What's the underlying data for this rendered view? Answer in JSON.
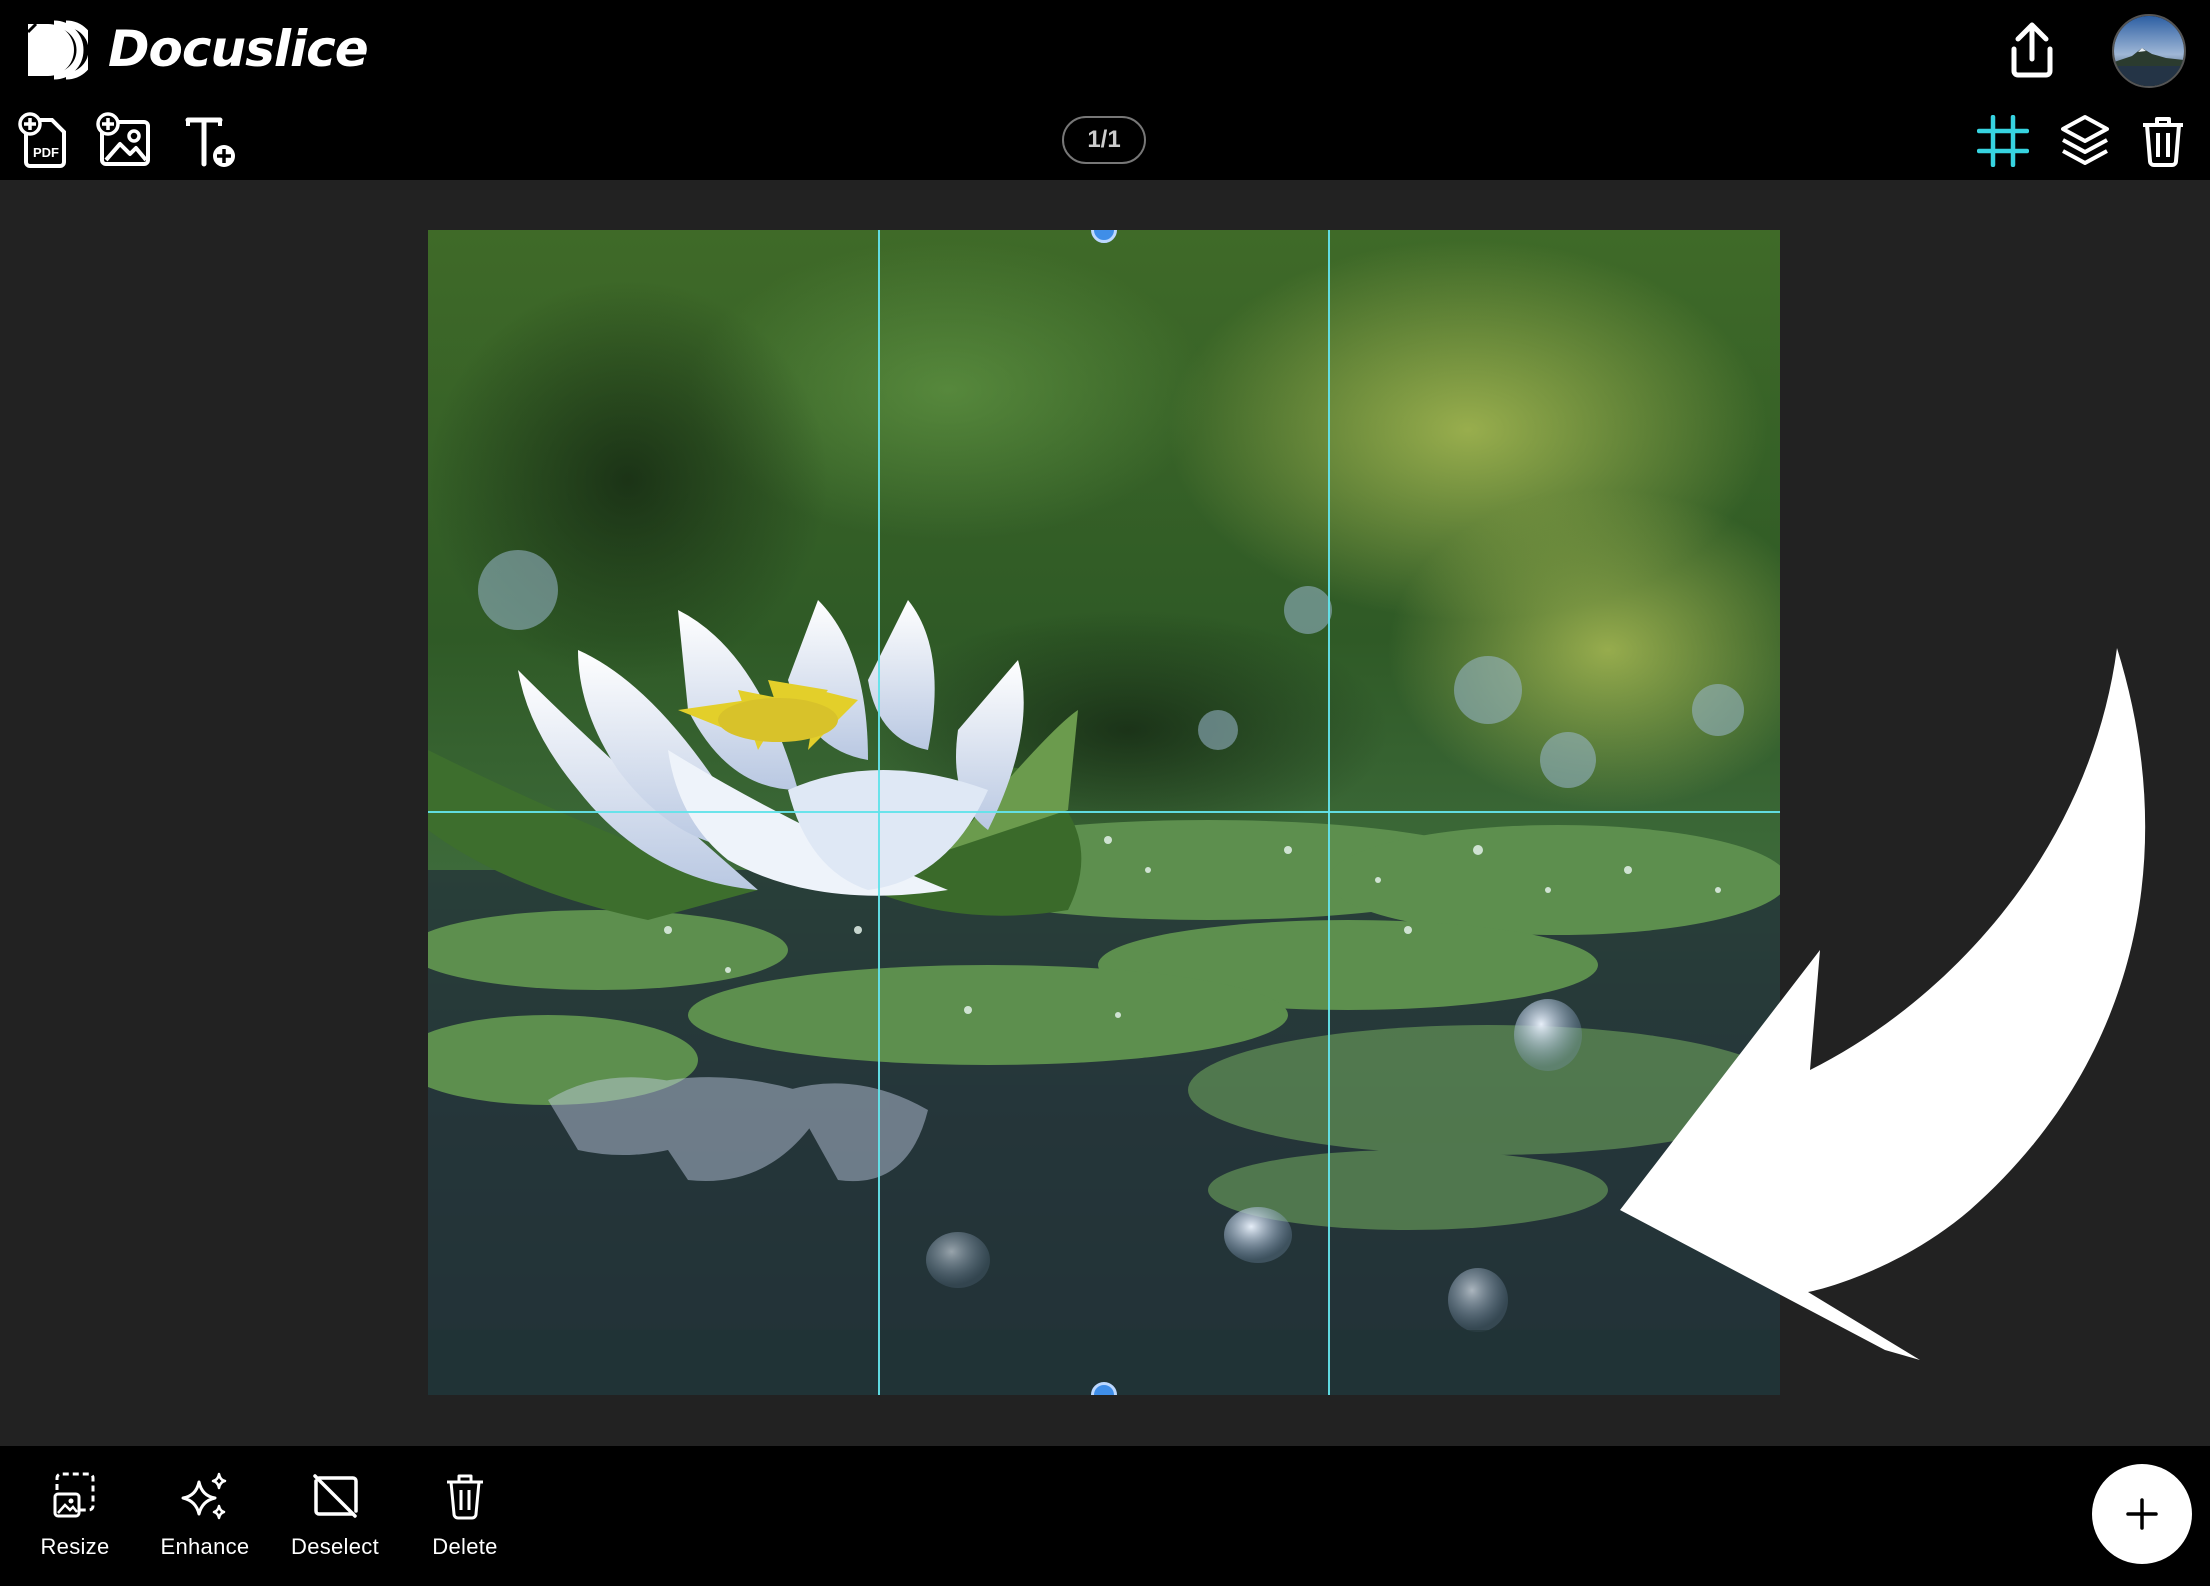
{
  "app": {
    "name": "Docuslice"
  },
  "toolbar": {
    "page_indicator": "1/1",
    "accent_color": "#37d3e0",
    "left_tools": [
      {
        "name": "add-pdf",
        "icon": "pdf-plus-icon",
        "badge": "PDF"
      },
      {
        "name": "add-image",
        "icon": "image-plus-icon"
      },
      {
        "name": "add-text",
        "icon": "text-plus-icon"
      }
    ],
    "right_tools": [
      {
        "name": "grid",
        "icon": "grid-icon",
        "active": true
      },
      {
        "name": "layers",
        "icon": "layers-icon"
      },
      {
        "name": "delete-all",
        "icon": "trash-icon"
      }
    ]
  },
  "header": {
    "share_icon": "share-upload-icon",
    "avatar_icon": "user-avatar"
  },
  "bottom_bar": {
    "actions": [
      {
        "label": "Resize",
        "icon": "resize-icon"
      },
      {
        "label": "Enhance",
        "icon": "sparkles-icon"
      },
      {
        "label": "Deselect",
        "icon": "deselect-icon"
      },
      {
        "label": "Delete",
        "icon": "trash-icon"
      }
    ],
    "fab_icon": "plus-icon"
  }
}
